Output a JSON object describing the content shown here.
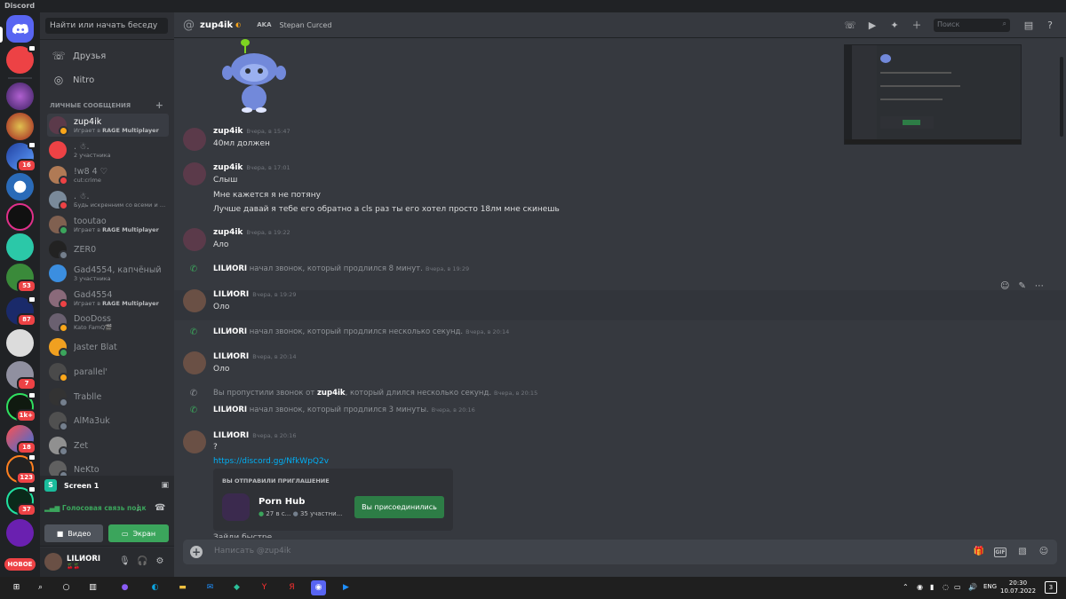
{
  "window_title": "Discord",
  "guilds": {
    "badges": [
      "16",
      "53",
      "87",
      "7",
      "1k+",
      "18",
      "123",
      "37"
    ],
    "new_label": "НОВОЕ"
  },
  "dm_sidebar": {
    "search_placeholder": "Найти или начать беседу",
    "friends": "Друзья",
    "nitro": "Nitro",
    "section_label": "Личные сообщения",
    "items": [
      {
        "name": "zup4ik",
        "sub_prefix": "Играет в ",
        "sub_bold": "RAGE Multiplayer",
        "avatar": "#5b3a4a",
        "status": "#faa61a"
      },
      {
        "name": ". ☃.",
        "sub": "2 участника",
        "avatar": "#ed4245"
      },
      {
        "name": "!w8 4 ♡",
        "sub": "cut:crime",
        "avatar": "#b07a55",
        "status": "#ed4245"
      },
      {
        "name": ". ☃.",
        "sub": "Будь искренним со всеми и р...",
        "avatar": "#7a8a9a",
        "status": "#ed4245"
      },
      {
        "name": "tooutao",
        "sub_prefix": "Играет в ",
        "sub_bold": "RAGE Multiplayer",
        "avatar": "#806050",
        "status": "#3ba55c"
      },
      {
        "name": "ZER0",
        "avatar": "#222",
        "status": "#747f8d"
      },
      {
        "name": "Gad4554, капчёный",
        "sub": "3 участника",
        "avatar": "#3b8ee0"
      },
      {
        "name": "Gad4554",
        "sub_prefix": "Играет в ",
        "sub_bold": "RAGE Multiplayer",
        "avatar": "#8a6a7a",
        "status": "#ed4245"
      },
      {
        "name": "DooDoss",
        "sub": "Kato FamQ🎬",
        "avatar": "#6a6070",
        "status": "#faa61a"
      },
      {
        "name": "Jaster Blat",
        "avatar": "#f0a020",
        "status": "#3ba55c"
      },
      {
        "name": "parallel'",
        "avatar": "#4a4a4a",
        "status": "#faa61a"
      },
      {
        "name": "Trablle",
        "avatar": "#333",
        "status": "#747f8d"
      },
      {
        "name": "AlMa3uk",
        "avatar": "#505050",
        "status": "#747f8d"
      },
      {
        "name": "Zet",
        "avatar": "#909090",
        "status": "#747f8d"
      },
      {
        "name": "NeKto",
        "avatar": "#606060",
        "status": "#747f8d"
      }
    ]
  },
  "voice_panel": {
    "stream_name": "Screen 1",
    "connected": "Голосовая связь подк",
    "video_label": "Видео",
    "screen_label": "Экран"
  },
  "user_panel": {
    "username": "LILИORI",
    "status": "🍒🍒"
  },
  "header": {
    "name": "zup4ik",
    "aka_label": "AKA",
    "aka_name": "Stepan Curced",
    "search_placeholder": "Поиск"
  },
  "messages": [
    {
      "author": "zup4ik",
      "time": "Вчера, в 15:47",
      "lines": [
        "40мл должен"
      ]
    },
    {
      "author": "zup4ik",
      "time": "Вчера, в 17:01",
      "lines": [
        "Слыш",
        "Мне кажется я не потяну",
        "Лучше давай я тебе его обратно а cls раз ты его хотел просто 18лм мне скинешь"
      ]
    },
    {
      "author": "zup4ik",
      "time": "Вчера, в 19:22",
      "lines": [
        "Ало"
      ]
    },
    {
      "type": "call",
      "author": "LILИORI",
      "text": "начал звонок, который продлился 8 минут.",
      "time": "Вчера, в 19:29"
    },
    {
      "author": "LILИORI",
      "time": "Вчера, в 19:29",
      "lines": [
        "Оло"
      ]
    },
    {
      "type": "call",
      "author": "LILИORI",
      "text": "начал звонок, который продлился несколько секунд.",
      "time": "Вчера, в 20:14"
    },
    {
      "author": "LILИORI",
      "time": "Вчера, в 20:14",
      "lines": [
        "Оло"
      ]
    },
    {
      "type": "missed",
      "prefix": "Вы пропустили звонок от",
      "author": "zup4ik",
      "text": "который длился несколько секунд.",
      "time": "Вчера, в 20:15"
    },
    {
      "type": "call",
      "author": "LILИORI",
      "text": "начал звонок, который продлился 3 минуты.",
      "time": "Вчера, в 20:16"
    },
    {
      "author": "LILИORI",
      "time": "Вчера, в 20:16",
      "lines": [
        "?"
      ],
      "link": "https://discord.gg/NfkWpQ2v"
    }
  ],
  "invite": {
    "title": "Вы отправили приглашение",
    "guild_name": "Porn Hub",
    "online": "27 в с...",
    "members": "35 участни...",
    "join_label": "Вы присоединились"
  },
  "partial_line": "Зайди быстре",
  "composer": {
    "placeholder": "Написать @zup4ik"
  },
  "taskbar": {
    "lang": "ENG",
    "time": "20:30",
    "date": "10.07.2022",
    "notif": "3"
  },
  "colors": {
    "accent": "#5865f2",
    "green": "#3ba55c",
    "red": "#ed4245",
    "link": "#00aff4"
  }
}
